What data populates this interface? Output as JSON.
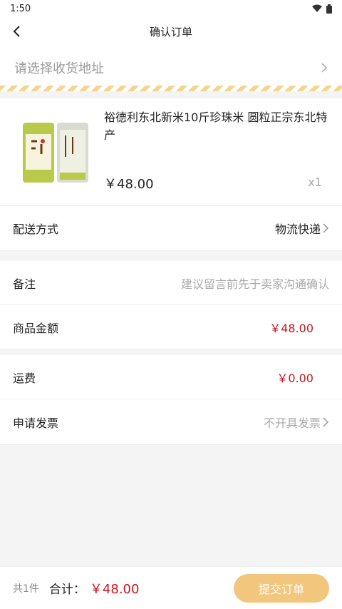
{
  "status_bar": {
    "time": "1:50"
  },
  "header": {
    "title": "确认订单"
  },
  "address": {
    "placeholder": "请选择收货地址"
  },
  "product": {
    "name": "裕德利东北新米10斤珍珠米 圆粒正宗东北特产",
    "price": "￥48.00",
    "quantity": "x1"
  },
  "delivery": {
    "label": "配送方式",
    "value": "物流快递"
  },
  "note": {
    "label": "备注",
    "placeholder": "建议留言前先于卖家沟通确认"
  },
  "goods_amount": {
    "label": "商品金额",
    "value": "￥48.00"
  },
  "shipping": {
    "label": "运费",
    "value": "￥0.00"
  },
  "invoice": {
    "label": "申请发票",
    "value": "不开具发票"
  },
  "footer": {
    "count": "共1件",
    "total_label": "合计：",
    "total": "￥48.00",
    "submit_label": "提交订单"
  },
  "colors": {
    "accent": "#f2c67d",
    "price_red": "#d0121b",
    "stripe": "#f5d58c"
  }
}
